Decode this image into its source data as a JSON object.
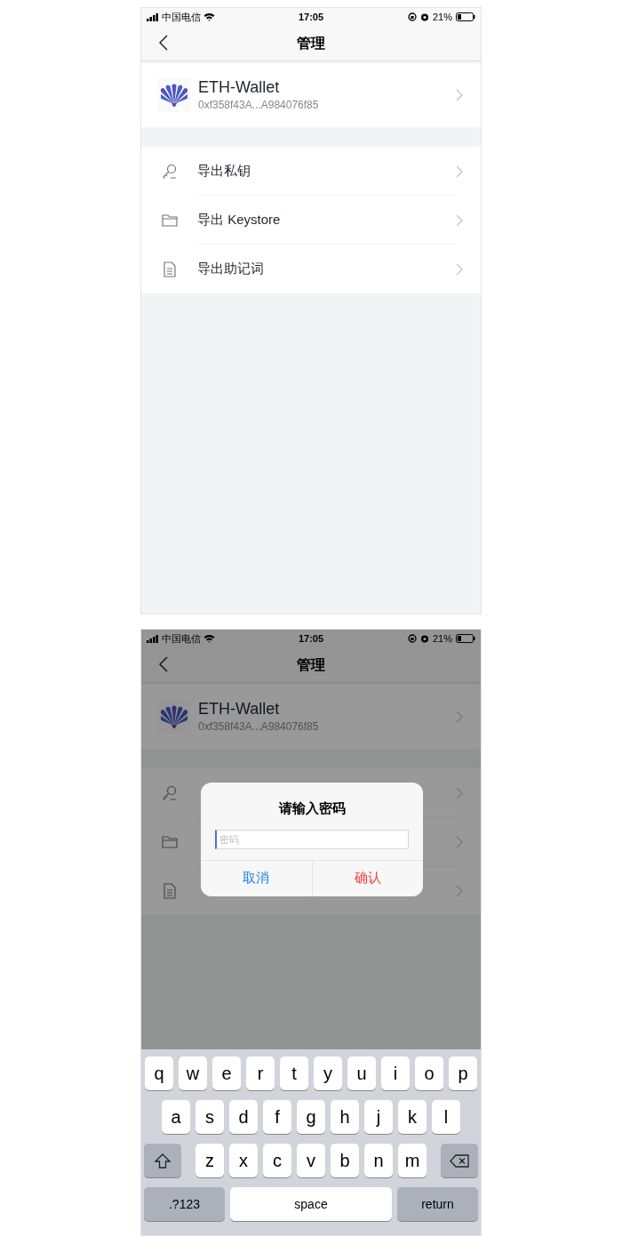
{
  "screens": [
    {
      "dimmed": false,
      "status_bar": {
        "carrier": "中国电信",
        "time": "17:05",
        "battery": "21%"
      },
      "nav": {
        "title": "管理"
      },
      "wallet": {
        "name": "ETH-Wallet",
        "address": "0xf358f43A...A984076f85"
      },
      "menu": [
        {
          "kind": "key",
          "label": "导出私钥"
        },
        {
          "kind": "folder",
          "label": "导出 Keystore"
        },
        {
          "kind": "document",
          "label": "导出助记词"
        }
      ]
    },
    {
      "dimmed": true,
      "status_bar": {
        "carrier": "中国电信",
        "time": "17:05",
        "battery": "21%"
      },
      "nav": {
        "title": "管理"
      },
      "wallet": {
        "name": "ETH-Wallet",
        "address": "0xf358f43A...A984076f85"
      },
      "menu": [
        {
          "kind": "key"
        },
        {
          "kind": "folder"
        },
        {
          "kind": "document"
        }
      ],
      "dialog": {
        "title": "请输入密码",
        "placeholder": "密码",
        "buttons": [
          {
            "kind": "cancel",
            "label": "取消"
          },
          {
            "kind": "confirm",
            "label": "确认"
          }
        ]
      },
      "keyboard": [
        [
          {
            "kind": "letter",
            "label": "q"
          },
          {
            "kind": "letter",
            "label": "w"
          },
          {
            "kind": "letter",
            "label": "e"
          },
          {
            "kind": "letter",
            "label": "r"
          },
          {
            "kind": "letter",
            "label": "t"
          },
          {
            "kind": "letter",
            "label": "y"
          },
          {
            "kind": "letter",
            "label": "u"
          },
          {
            "kind": "letter",
            "label": "i"
          },
          {
            "kind": "letter",
            "label": "o"
          },
          {
            "kind": "letter",
            "label": "p"
          }
        ],
        [
          {
            "kind": "letter",
            "label": "a"
          },
          {
            "kind": "letter",
            "label": "s"
          },
          {
            "kind": "letter",
            "label": "d"
          },
          {
            "kind": "letter",
            "label": "f"
          },
          {
            "kind": "letter",
            "label": "g"
          },
          {
            "kind": "letter",
            "label": "h"
          },
          {
            "kind": "letter",
            "label": "j"
          },
          {
            "kind": "letter",
            "label": "k"
          },
          {
            "kind": "letter",
            "label": "l"
          }
        ],
        [
          {
            "kind": "shift"
          },
          {
            "kind": "letter",
            "label": "z"
          },
          {
            "kind": "letter",
            "label": "x"
          },
          {
            "kind": "letter",
            "label": "c"
          },
          {
            "kind": "letter",
            "label": "v"
          },
          {
            "kind": "letter",
            "label": "b"
          },
          {
            "kind": "letter",
            "label": "n"
          },
          {
            "kind": "letter",
            "label": "m"
          },
          {
            "kind": "delete"
          }
        ],
        [
          {
            "kind": "mode",
            "label": ".?123"
          },
          {
            "kind": "space",
            "label": "space"
          },
          {
            "kind": "return",
            "label": "return"
          }
        ]
      ]
    }
  ]
}
